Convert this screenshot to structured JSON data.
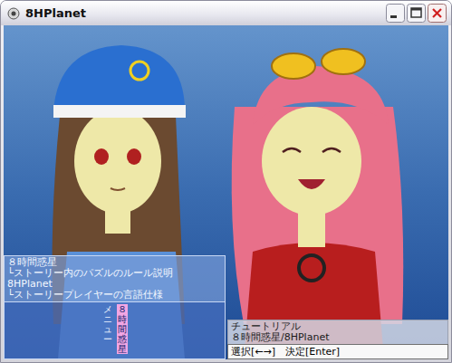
{
  "window": {
    "title": "8HPlanet"
  },
  "info_panel": {
    "lines": [
      "８時間惑星",
      "└ストーリー内のパズルのルール説明",
      "8HPlanet",
      "└ストーリープレイヤーの言語仕様"
    ]
  },
  "vertical_menu": {
    "items": [
      {
        "label": "メニュー",
        "selected": false
      },
      {
        "label": "８時間惑星",
        "selected": true
      }
    ]
  },
  "tutorial_panel": {
    "lines": [
      "チュートリアル",
      "８時間惑星/8HPlanet"
    ]
  },
  "status_bar": {
    "text": "選択[←→]　決定[Enter]"
  }
}
